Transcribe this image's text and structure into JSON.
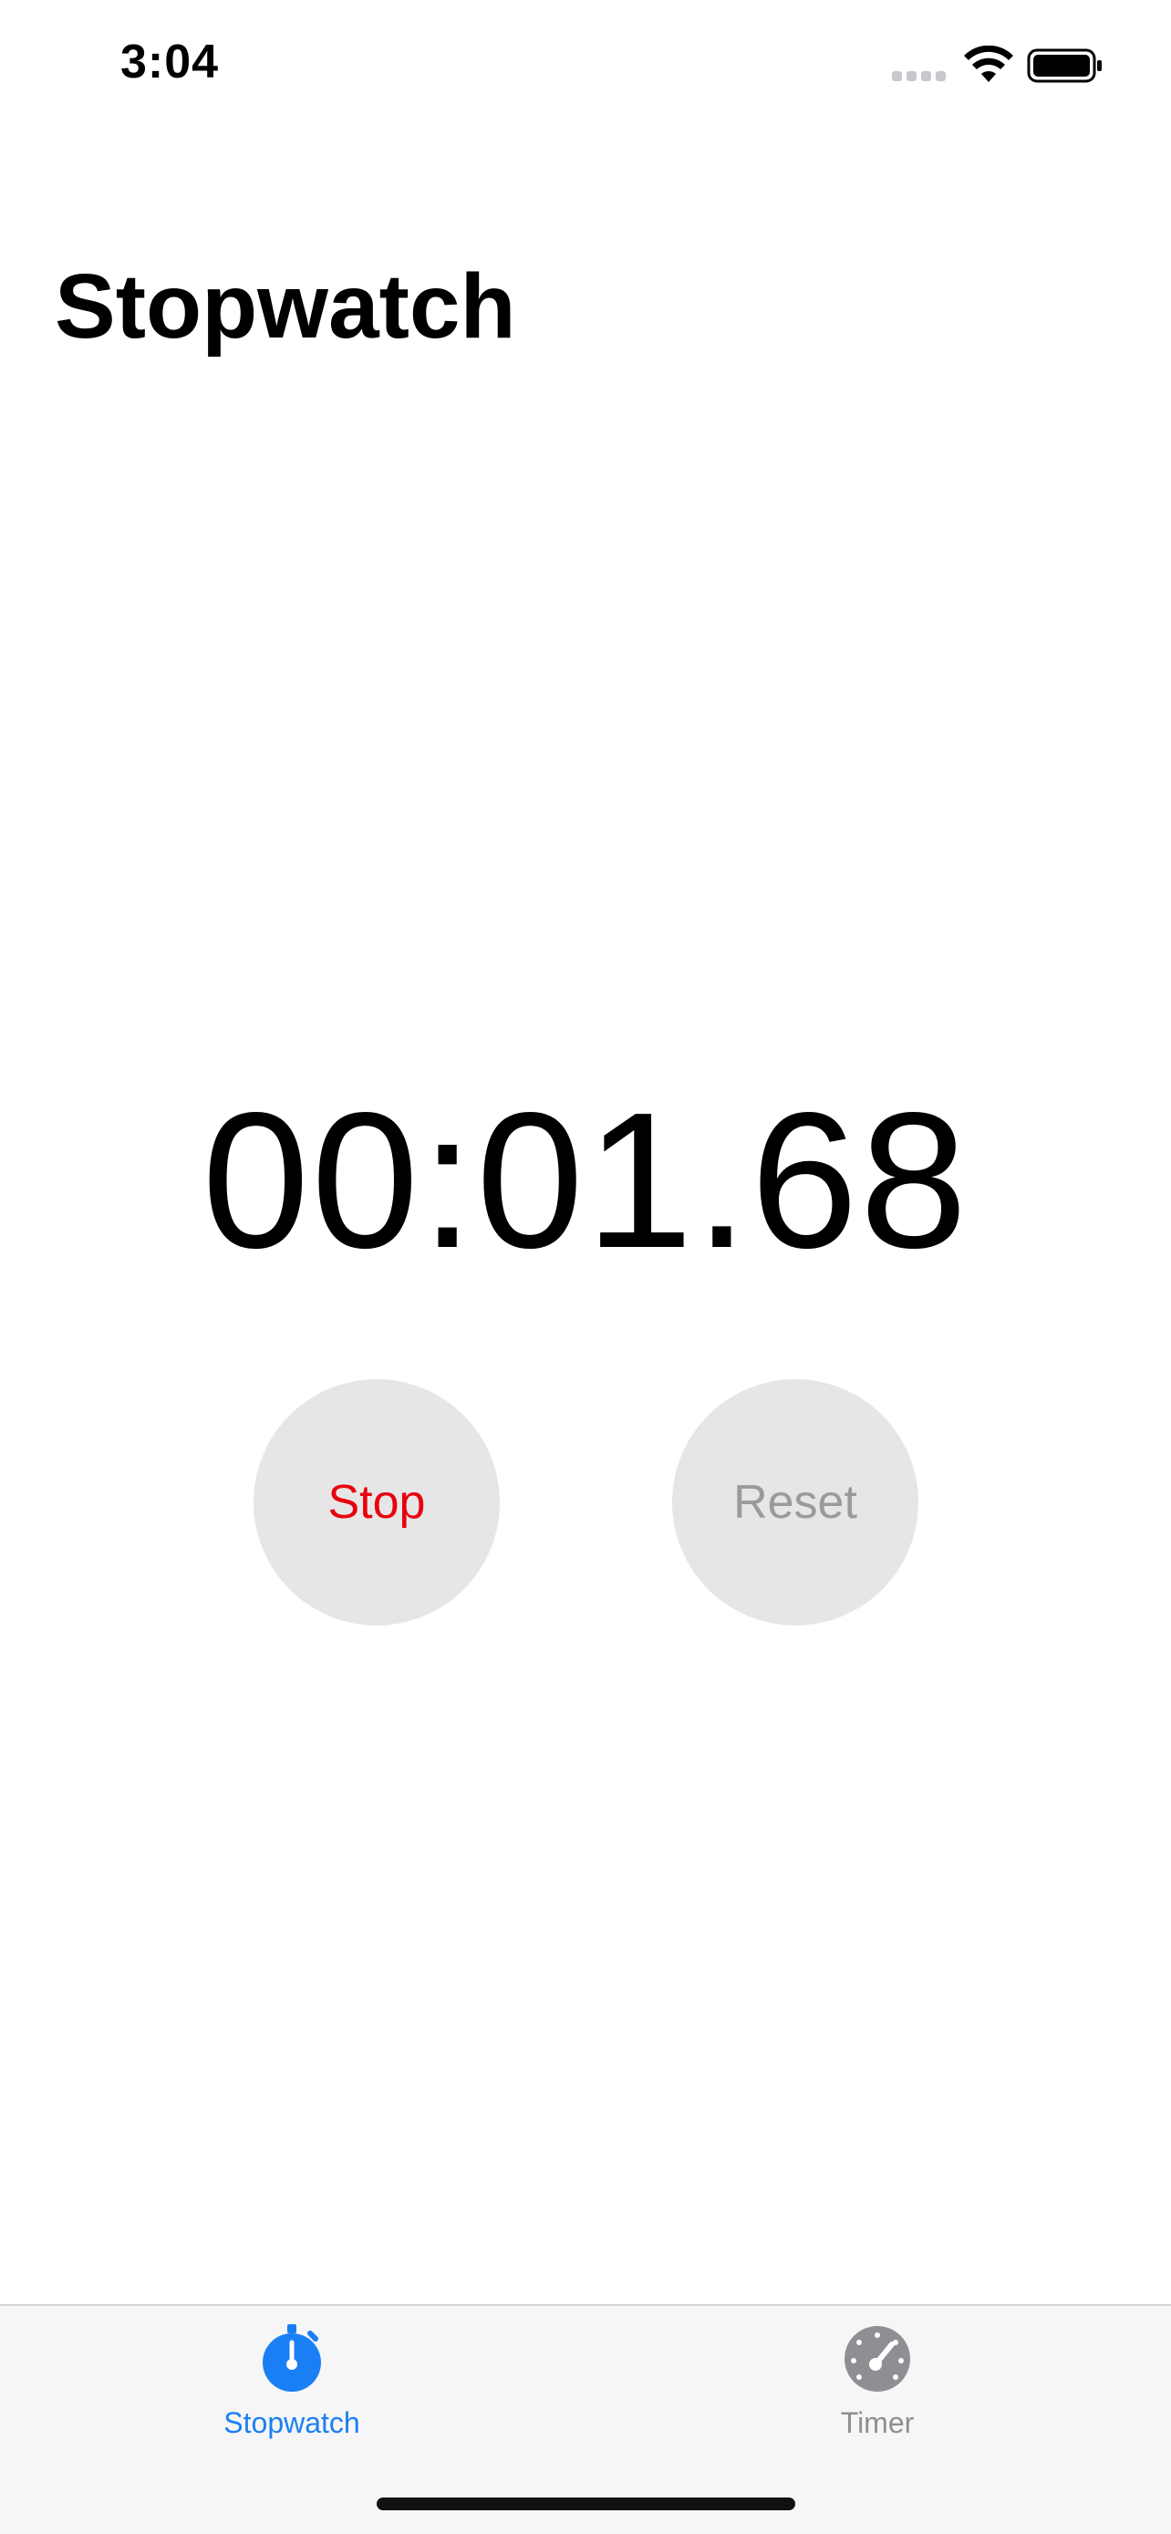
{
  "status_bar": {
    "time": "3:04"
  },
  "header": {
    "title": "Stopwatch"
  },
  "stopwatch": {
    "elapsed": "00:01.68"
  },
  "controls": {
    "stop_label": "Stop",
    "reset_label": "Reset",
    "stop_color": "#e8000d",
    "reset_color": "#9a9a9a",
    "button_bg": "#e6e6e6"
  },
  "tab_bar": {
    "tabs": [
      {
        "label": "Stopwatch",
        "icon": "stopwatch-icon",
        "selected": true,
        "color": "#1a7ff5"
      },
      {
        "label": "Timer",
        "icon": "timer-gauge-icon",
        "selected": false,
        "color": "#8e8e93"
      }
    ]
  }
}
